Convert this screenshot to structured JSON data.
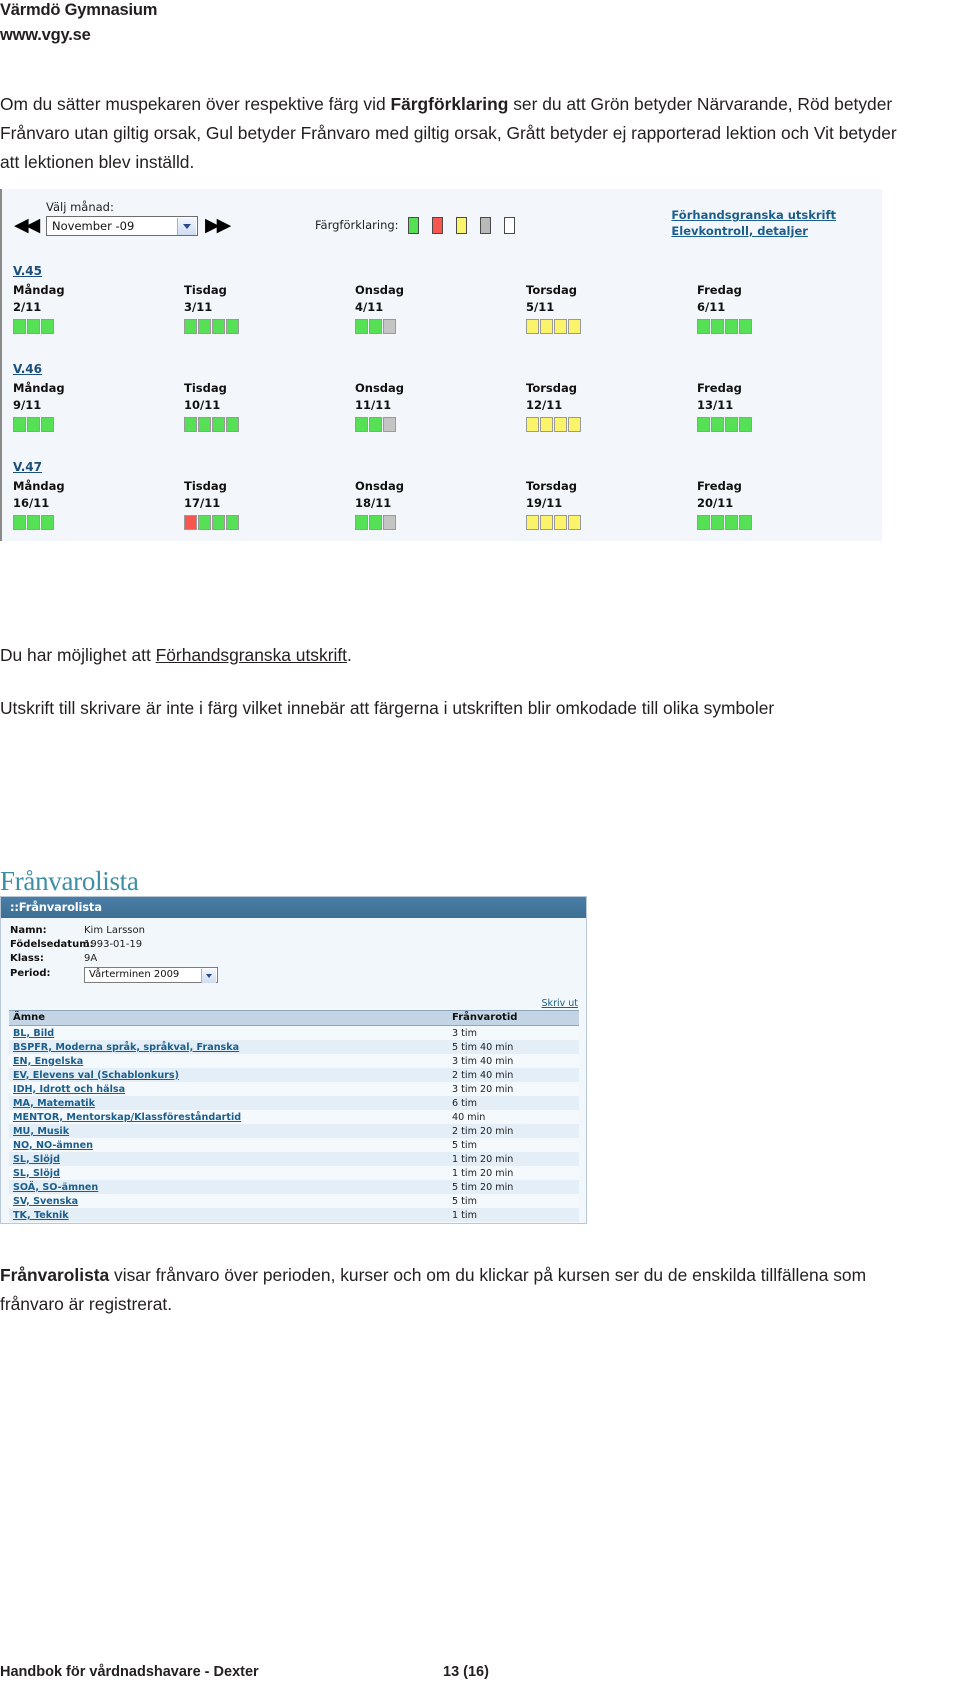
{
  "header": {
    "school": "Värmdö Gymnasium",
    "url": "www.vgy.se"
  },
  "intro": {
    "part1": "Om du sätter muspekaren över respektive färg vid ",
    "bold1": "Färgförklaring",
    "part2": " ser du att Grön betyder Närvarande, Röd betyder Frånvaro utan giltig orsak, Gul betyder Frånvaro med giltig orsak, Grått betyder ej rapporterad lektion och Vit betyder att lektionen blev inställd."
  },
  "calendar": {
    "month_label": "Välj månad:",
    "month_value": "November -09",
    "prev_icon": "◀◀",
    "next_icon": "▶▶",
    "legend_label": "Färgförklaring:",
    "legend_colors": [
      "#55e055",
      "#f9564f",
      "#fbf36a",
      "#b9b9b9",
      "#ffffff"
    ],
    "legend_names": [
      "green-present",
      "red-unexcused-absence",
      "yellow-excused-absence",
      "gray-not-reported",
      "white-cancelled"
    ],
    "links": [
      "Förhandsgranska utskrift",
      "Elevkontroll, detaljer"
    ],
    "weeks": [
      {
        "week": "V.45",
        "days": [
          {
            "name": "Måndag",
            "date": "2/11",
            "blocks": [
              "green",
              "green",
              "green"
            ]
          },
          {
            "name": "Tisdag",
            "date": "3/11",
            "blocks": [
              "green",
              "green",
              "green",
              "green"
            ]
          },
          {
            "name": "Onsdag",
            "date": "4/11",
            "blocks": [
              "green",
              "green",
              "gray"
            ]
          },
          {
            "name": "Torsdag",
            "date": "5/11",
            "blocks": [
              "yellow",
              "yellow",
              "yellow",
              "yellow"
            ]
          },
          {
            "name": "Fredag",
            "date": "6/11",
            "blocks": [
              "green",
              "green",
              "green",
              "green"
            ]
          }
        ]
      },
      {
        "week": "V.46",
        "days": [
          {
            "name": "Måndag",
            "date": "9/11",
            "blocks": [
              "green",
              "green",
              "green"
            ]
          },
          {
            "name": "Tisdag",
            "date": "10/11",
            "blocks": [
              "green",
              "green",
              "green",
              "green"
            ]
          },
          {
            "name": "Onsdag",
            "date": "11/11",
            "blocks": [
              "green",
              "green",
              "gray"
            ]
          },
          {
            "name": "Torsdag",
            "date": "12/11",
            "blocks": [
              "yellow",
              "yellow",
              "yellow",
              "yellow"
            ]
          },
          {
            "name": "Fredag",
            "date": "13/11",
            "blocks": [
              "green",
              "green",
              "green",
              "green"
            ]
          }
        ]
      },
      {
        "week": "V.47",
        "days": [
          {
            "name": "Måndag",
            "date": "16/11",
            "blocks": [
              "green",
              "green",
              "green"
            ]
          },
          {
            "name": "Tisdag",
            "date": "17/11",
            "blocks": [
              "red",
              "green",
              "green",
              "green"
            ]
          },
          {
            "name": "Onsdag",
            "date": "18/11",
            "blocks": [
              "green",
              "green",
              "gray"
            ]
          },
          {
            "name": "Torsdag",
            "date": "19/11",
            "blocks": [
              "yellow",
              "yellow",
              "yellow",
              "yellow"
            ]
          },
          {
            "name": "Fredag",
            "date": "20/11",
            "blocks": [
              "green",
              "green",
              "green",
              "green"
            ]
          }
        ]
      }
    ]
  },
  "mid": {
    "line1_pre": "Du har möjlighet att ",
    "line1_link": "Förhandsgranska utskrift",
    "line1_post": ".",
    "line2": "Utskrift till skrivare är inte i färg vilket innebär att färgerna i utskriften blir omkodade till olika symboler"
  },
  "franvarolista": {
    "heading": "Frånvarolista",
    "titlebar": "::Frånvarolista",
    "meta": [
      {
        "key": "Namn:",
        "value": "Kim Larsson"
      },
      {
        "key": "Födelsedatum:",
        "value": "1993-01-19"
      },
      {
        "key": "Klass:",
        "value": "9A"
      }
    ],
    "period_key": "Period:",
    "period_value": "Vårterminen 2009",
    "print_link": "Skriv ut",
    "columns": [
      "Ämne",
      "Frånvarotid"
    ],
    "rows": [
      {
        "subject": "BL, Bild",
        "time": "3 tim"
      },
      {
        "subject": "BSPFR, Moderna språk, språkval, Franska",
        "time": "5 tim 40 min"
      },
      {
        "subject": "EN, Engelska",
        "time": "3 tim 40 min"
      },
      {
        "subject": "EV, Elevens val (Schablonkurs)",
        "time": "2 tim 40 min"
      },
      {
        "subject": "IDH, Idrott och hälsa",
        "time": "3 tim 20 min"
      },
      {
        "subject": "MA, Matematik",
        "time": "6 tim"
      },
      {
        "subject": "MENTOR, Mentorskap/Klassföreståndartid",
        "time": "40 min"
      },
      {
        "subject": "MU, Musik",
        "time": "2 tim 20 min"
      },
      {
        "subject": "NO, NO-ämnen",
        "time": "5 tim"
      },
      {
        "subject": "SL, Slöjd",
        "time": "1 tim 20 min"
      },
      {
        "subject": "SL, Slöjd",
        "time": "1 tim 20 min"
      },
      {
        "subject": "SOÄ, SO-ämnen",
        "time": "5 tim 20 min"
      },
      {
        "subject": "SV, Svenska",
        "time": "5 tim"
      },
      {
        "subject": "TK, Teknik",
        "time": "1 tim"
      }
    ]
  },
  "bottom": {
    "bold": "Frånvarolista",
    "text": " visar frånvaro över perioden, kurser och om du klickar på kursen ser du de enskilda tillfällena som frånvaro är registrerat."
  },
  "footer": {
    "left": "Handbok för vårdnadshavare - Dexter",
    "page": "13 (16)"
  }
}
